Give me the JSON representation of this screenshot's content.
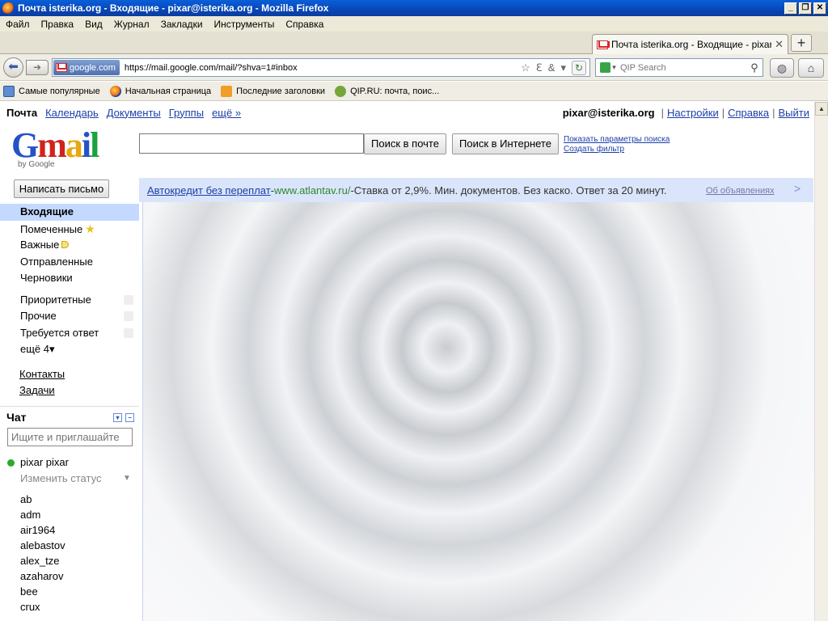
{
  "window": {
    "title": "Почта isterika.org - Входящие - pixar@isterika.org - Mozilla Firefox",
    "min": "_",
    "max": "❐",
    "close": "✕"
  },
  "menu": [
    "Файл",
    "Правка",
    "Вид",
    "Журнал",
    "Закладки",
    "Инструменты",
    "Справка"
  ],
  "tab": {
    "title": "Почта isterika.org - Входящие - pixar...",
    "close": "✕",
    "new": "+"
  },
  "nav": {
    "identity": "google.com",
    "url": "https://mail.google.com/mail/?shva=1#inbox",
    "search_placeholder": "QIP Search"
  },
  "bookmarks": [
    {
      "label": "Самые популярные",
      "icon": "popular"
    },
    {
      "label": "Начальная страница",
      "icon": "ffox"
    },
    {
      "label": "Последние заголовки",
      "icon": "rss"
    },
    {
      "label": "QIP.RU: почта, поис...",
      "icon": "qip"
    }
  ],
  "gmail": {
    "topnav": {
      "mail": "Почта",
      "calendar": "Календарь",
      "docs": "Документы",
      "groups": "Группы",
      "more": "ещё »"
    },
    "account": {
      "user": "pixar@isterika.org",
      "settings": "Настройки",
      "help": "Справка",
      "logout": "Выйти",
      "sep": "|"
    },
    "logo": {
      "g": "G",
      "m": "m",
      "a": "a",
      "i": "i",
      "l": "l",
      "by": "by Google"
    },
    "search": {
      "mail_button": "Поиск в почте",
      "web_button": "Поиск в Интернете",
      "show_options": "Показать параметры поиска",
      "create_filter": "Создать фильтр"
    },
    "compose": "Написать письмо",
    "ad": {
      "title": "Автокредит без переплат",
      "dash1": " - ",
      "url": "www.atlantav.ru/",
      "dash2": " - ",
      "text": "Ставка от 2,9%. Мин. документов. Без каско. Ответ за 20 минут.",
      "about": "Об объявлениях",
      "next": ">"
    },
    "folders": [
      {
        "label": "Входящие"
      },
      {
        "label": "Помеченные"
      },
      {
        "label": "Важные"
      },
      {
        "label": "Отправленные"
      },
      {
        "label": "Черновики"
      }
    ],
    "labels": [
      {
        "label": "Приоритетные"
      },
      {
        "label": "Прочие"
      },
      {
        "label": "Требуется ответ"
      }
    ],
    "more_labels": "ещё 4▾",
    "contacts": "Контакты",
    "tasks": "Задачи",
    "chat": {
      "title": "Чат",
      "search_placeholder": "Ищите и приглашайте",
      "me": "pixar pixar",
      "status": "Изменить статус",
      "contacts": [
        "ab",
        "adm",
        "air1964",
        "alebastov",
        "alex_tze",
        "azaharov",
        "bee",
        "crux"
      ]
    }
  }
}
